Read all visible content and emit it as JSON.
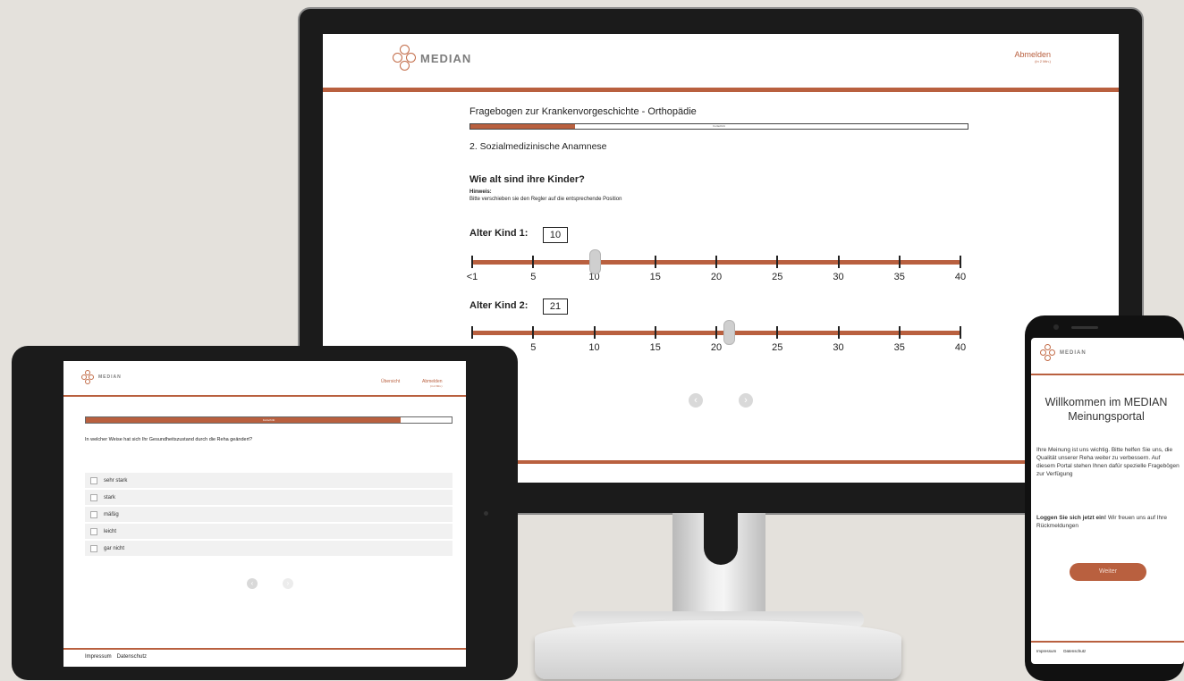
{
  "brand": {
    "name": "MEDIAN",
    "accent_color": "#b9603f"
  },
  "desktop": {
    "logout_label": "Abmelden",
    "logout_sub": "(in 2 Min.)",
    "questionnaire_title": "Fragebogen zur Krankenvorgeschichte - Orthopädie",
    "progress": {
      "fraction": 0.21,
      "label": "Fortschritt"
    },
    "section_title": "2. Sozialmedizinische Anamnese",
    "question": "Wie alt sind ihre Kinder?",
    "hint_label": "Hinweis:",
    "hint_text": "Bitte verschieben sie den Regler auf die entsprechende Position",
    "scale_ticks": [
      "<1",
      "5",
      "10",
      "15",
      "20",
      "25",
      "30",
      "35",
      "40"
    ],
    "scale_ticks_2": [
      "",
      "5",
      "10",
      "15",
      "20",
      "25",
      "30",
      "35",
      "40"
    ],
    "sliders": [
      {
        "label": "Alter Kind 1:",
        "value": "10",
        "numeric": 10
      },
      {
        "label": "Alter Kind 2:",
        "value": "21",
        "numeric": 21
      }
    ],
    "nav": {
      "prev_icon": "chevron-left-icon",
      "next_icon": "chevron-right-icon",
      "prev_glyph": "‹",
      "next_glyph": "›"
    }
  },
  "tablet": {
    "overview_label": "Übersicht",
    "logout_label": "Abmelden",
    "logout_sub": "(in 2 Min.)",
    "progress": {
      "fraction": 0.86,
      "label": "Fortschritt"
    },
    "question": "In welcher Weise hat sich Ihr Gesundheitszustand durch die Reha geändert?",
    "options": [
      "sehr stark",
      "stark",
      "mäßig",
      "leicht",
      "gar nicht"
    ],
    "footer_links": [
      "Impressum",
      "Datenschutz"
    ],
    "nav": {
      "prev_glyph": "‹",
      "next_glyph": "›"
    }
  },
  "phone": {
    "welcome_title": "Willkommen im MEDIAN Meinungsportal",
    "intro_text": "Ihre Meinung ist uns wichtig. Bitte helfen Sie uns, die Qualität unserer Reha weiter zu verbessern. Auf diesem Portal stehen Ihnen dafür spezielle Fragebögen zur Verfügung",
    "login_bold": "Loggen Sie sich jetzt ein!",
    "login_rest": " Wir freuen uns auf Ihre Rückmeldungen",
    "continue_button": "Weiter",
    "footer_links": [
      "Impressum",
      "Datenschutz"
    ]
  }
}
